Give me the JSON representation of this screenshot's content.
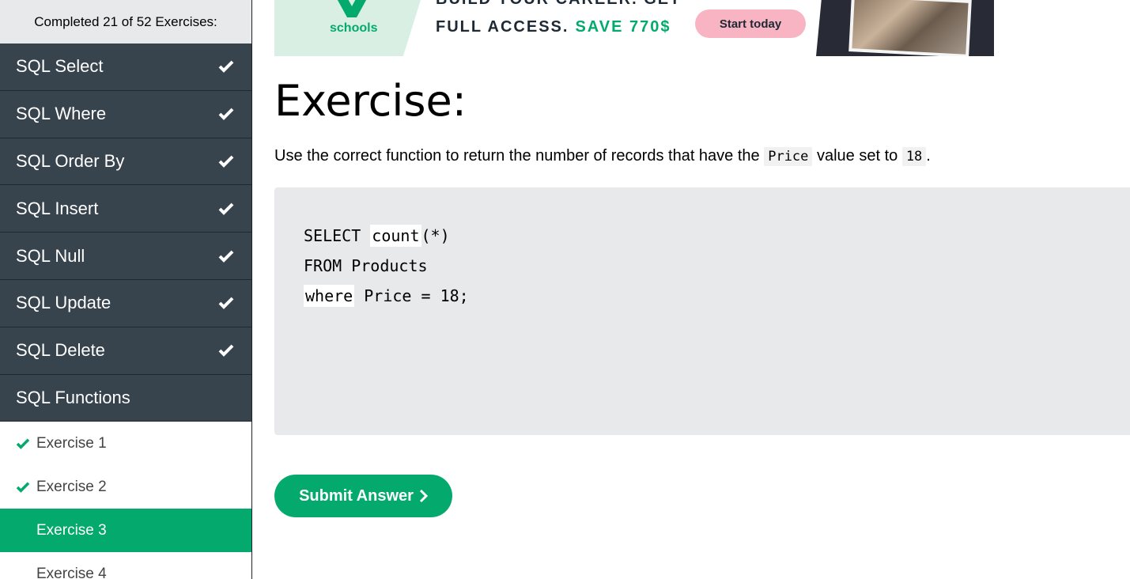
{
  "sidebar": {
    "progress_text": "Completed 21 of 52 Exercises:",
    "chapters": [
      {
        "label": "SQL Select",
        "completed": true
      },
      {
        "label": "SQL Where",
        "completed": true
      },
      {
        "label": "SQL Order By",
        "completed": true
      },
      {
        "label": "SQL Insert",
        "completed": true
      },
      {
        "label": "SQL Null",
        "completed": true
      },
      {
        "label": "SQL Update",
        "completed": true
      },
      {
        "label": "SQL Delete",
        "completed": true
      },
      {
        "label": "SQL Functions",
        "completed": false
      }
    ],
    "exercises": [
      {
        "label": "Exercise 1",
        "completed": true,
        "current": false
      },
      {
        "label": "Exercise 2",
        "completed": true,
        "current": false
      },
      {
        "label": "Exercise 3",
        "completed": false,
        "current": true
      },
      {
        "label": "Exercise 4",
        "completed": false,
        "current": false
      }
    ]
  },
  "banner": {
    "logo_text": "schools",
    "headline_top": "BUILD YOUR CAREER. GET",
    "headline": "FULL ACCESS.",
    "save_text": "SAVE 770$",
    "cta_label": "Start today"
  },
  "main": {
    "title": "Exercise:",
    "instruction_pre": "Use the correct function to return the number of records that have the ",
    "instruction_code1": "Price",
    "instruction_mid": " value set to ",
    "instruction_code2": "18",
    "instruction_post": ".",
    "code": {
      "line1_kw": "SELECT",
      "line1_answer": "count",
      "line1_rest": "(*)",
      "line2": "FROM Products",
      "line3_answer": "where",
      "line3_rest": "Price = 18;"
    },
    "submit_label": "Submit Answer"
  },
  "colors": {
    "accent_green": "#04aa6d",
    "sidebar_dark": "#38444d",
    "code_bg": "#e7e9eb"
  }
}
